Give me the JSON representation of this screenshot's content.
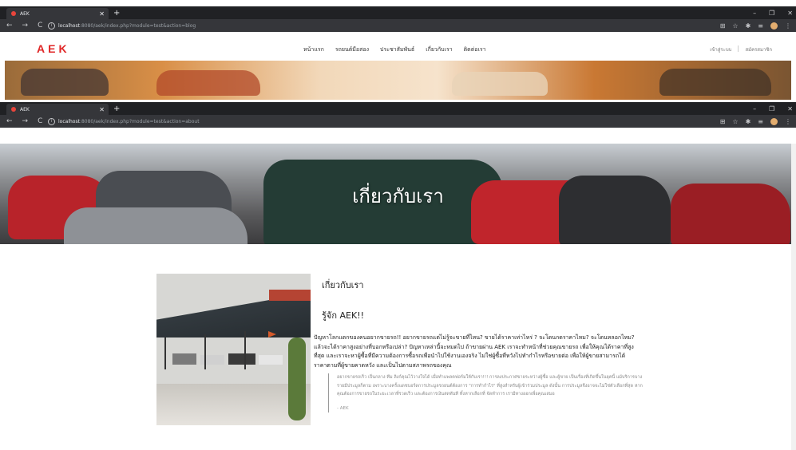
{
  "browser_top": {
    "tab_title": "AEK",
    "url_host": "localhost",
    "url_rest": ":8080/aek/index.php?module=test&action=blog"
  },
  "browser_bottom": {
    "tab_title": "AEK",
    "url_host": "localhost",
    "url_rest": ":8080/aek/index.php?module=test&action=about"
  },
  "site": {
    "logo": "AEK",
    "menu": [
      "หน้าแรก",
      "รถยนต์มือสอง",
      "ประชาสัมพันธ์",
      "เกี่ยวกับเรา",
      "ติดต่อเรา"
    ],
    "login": "เข้าสู่ระบบ",
    "register": "สมัครสมาชิก"
  },
  "hero": {
    "title": "เกี่ยวกับเรา"
  },
  "about": {
    "section_title": "เกี่ยวกับเรา",
    "heading": "รู้จัก AEK!!",
    "body": "ปัญหาโลกแตกของคนอยากขายรถ!! อยากขายรถแต่ไม่รู้จะขายที่ไหน? ขายได้ราคาเท่าไหร่ ? จะโดนกดราคาไหม? จะโดนหลอกไหม? แล้วจะได้ราคาสูงอย่างที่บอกหรือเปล่า? ปัญหาเหล่านี้จะหมดไป ถ้าขายผ่าน AEK เราจะทำหน้าที่ช่วยคุณขายรถ เพื่อให้คุณได้ราคาที่สูงที่สุด และเราจะหาผู้ซื้อที่มีความต้องการซื้อรถเพื่อนำไปใช้งานเองจริง ไม่ใช่ผู้ซื้อที่หวังไปทำกำไรหรือขายต่อ เพื่อให้ผู้ขายสามารถได้ราคาตามที่ผู้ขายคาดหวัง และเป็นไปตามสภาพรถของคุณ",
    "quote": "อยากขายรถเร็ว เป็นกลาง ทีม ลิงก์คุณไว้วางใจได้ เมื่อทำแพลตฟอร์มให้กับเรา!!! การลงประกาศขายระหว่างผู้ซื้อ และผู้ขาย เป็นเรื่องที่เกิดขึ้นในยุคนี้ แม้บริการบางรายมีประมูลก็ตาม เพราะบางครั้งแดชบอร์ดการประมูลรถยนต์ต้องการ \"การทำกำไร\" ที่สูงสำหรับผู้เข้าร่วมประมูล ดังนั้น การประมูลจึงอาจจะไม่ใช่ตัวเลือกที่สุด หากคุณต้องการขายรถในระยะเวลาที่รวดเร็ว และต้องการเงินสดทันที ทั้งหากเลือกที่ จัดทำการ เรามีทางออกเพื่อคุณเสมอ",
    "quote_by": "- AEK"
  }
}
